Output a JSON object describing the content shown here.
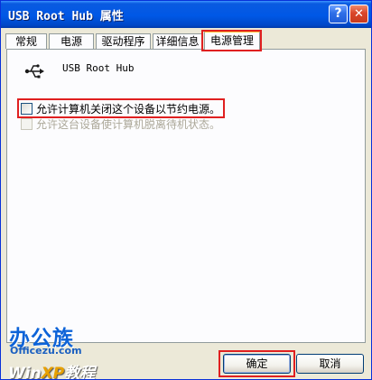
{
  "window": {
    "title": "USB Root Hub 属性"
  },
  "title_buttons": {
    "help": "?",
    "close": "✕"
  },
  "tabs": [
    {
      "label": "常规"
    },
    {
      "label": "电源"
    },
    {
      "label": "驱动程序"
    },
    {
      "label": "详细信息"
    },
    {
      "label": "电源管理",
      "active": true
    }
  ],
  "device": {
    "name": "USB Root Hub",
    "icon": "usb-icon"
  },
  "options": [
    {
      "label": "允许计算机关闭这个设备以节约电源。",
      "checked": false,
      "enabled": true
    },
    {
      "label": "允许这台设备使计算机脱离待机状态。",
      "checked": false,
      "enabled": false
    }
  ],
  "watermark": {
    "brand": "办公族",
    "site": "Officezu.com",
    "win": "Win",
    "xp": "XP",
    "tutorial": "教程"
  },
  "buttons": {
    "ok": "确定",
    "cancel": "取消"
  },
  "colors": {
    "highlight": "#e02020",
    "titlebar": "#0058e6"
  }
}
